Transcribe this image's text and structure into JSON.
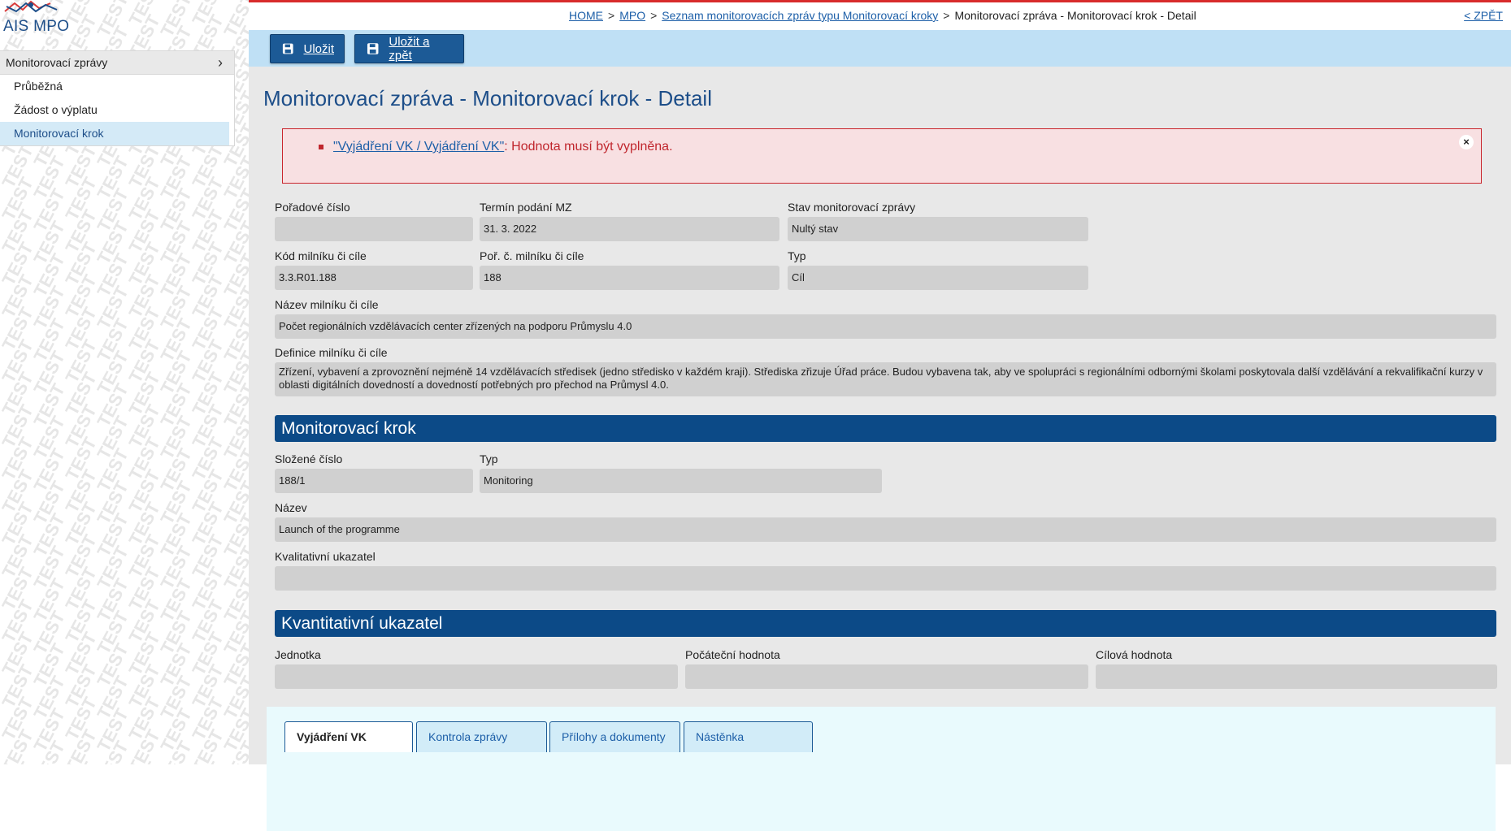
{
  "app": {
    "logo_text": "AIS MPO"
  },
  "sidebar": {
    "section_label": "Monitorovací zprávy",
    "items": [
      {
        "label": "Průběžná",
        "active": false
      },
      {
        "label": "Žádost o výplatu",
        "active": false
      },
      {
        "label": "Monitorovací krok",
        "active": true
      }
    ]
  },
  "watermark_text": "TEST",
  "breadcrumb": {
    "items": [
      "HOME",
      "MPO",
      "Seznam monitorovacích zpráv typu Monitorovací kroky"
    ],
    "current": "Monitorovací zpráva - Monitorovací krok - Detail"
  },
  "back_link": "< ZPĚT",
  "toolbar": {
    "save_label": "Uložit",
    "save_back_label": "Uložit a zpět"
  },
  "page_title": "Monitorovací zpráva - Monitorovací krok - Detail",
  "alert": {
    "field_link": "\"Vyjádření VK / Vyjádření VK\"",
    "message": ": Hodnota musí být vyplněna.",
    "close": "×"
  },
  "fields": {
    "poradove_cislo": {
      "label": "Pořadové číslo",
      "value": ""
    },
    "termin_podani": {
      "label": "Termín podání MZ",
      "value": "31. 3. 2022"
    },
    "stav_zpravy": {
      "label": "Stav monitorovací zprávy",
      "value": "Nultý stav"
    },
    "kod_milniku": {
      "label": "Kód milníku či cíle",
      "value": "3.3.R01.188"
    },
    "por_c_milniku": {
      "label": "Poř. č. milníku či cíle",
      "value": "188"
    },
    "typ_milniku": {
      "label": "Typ",
      "value": "Cíl"
    },
    "nazev_milniku": {
      "label": "Název milníku či cíle",
      "value": "Počet regionálních vzdělávacích center zřízených na podporu Průmyslu 4.0"
    },
    "definice_milniku": {
      "label": "Definice milníku či cíle",
      "value": "Zřízení, vybavení a zprovoznění nejméně 14 vzdělávacích středisek (jedno středisko v každém kraji). Střediska zřizuje Úřad práce. Budou vybavena tak, aby ve spolupráci s regionálními odbornými školami poskytovala další vzdělávání a rekvalifikační kurzy v oblasti digitálních dovedností a dovedností potřebných pro přechod na Průmysl 4.0."
    }
  },
  "section_monitoring": {
    "title": "Monitorovací krok",
    "slozene_cislo": {
      "label": "Složené číslo",
      "value": "188/1"
    },
    "typ": {
      "label": "Typ",
      "value": "Monitoring"
    },
    "nazev": {
      "label": "Název",
      "value": "Launch of the programme"
    },
    "kvalitativni": {
      "label": "Kvalitativní ukazatel",
      "value": ""
    }
  },
  "section_quant": {
    "title": "Kvantitativní ukazatel",
    "jednotka": {
      "label": "Jednotka",
      "value": ""
    },
    "pocatecni": {
      "label": "Počáteční hodnota",
      "value": ""
    },
    "cilova": {
      "label": "Cílová hodnota",
      "value": ""
    }
  },
  "tabs": [
    {
      "label": "Vyjádření VK",
      "active": true
    },
    {
      "label": "Kontrola zprávy",
      "active": false
    },
    {
      "label": "Přílohy a dokumenty",
      "active": false
    },
    {
      "label": "Nástěnka",
      "active": false
    }
  ],
  "colors": {
    "brand_blue": "#1c5a96",
    "section_blue": "#0c4a87",
    "alert_red": "#c0262d",
    "toolbar_bg": "#bfe0f5"
  }
}
